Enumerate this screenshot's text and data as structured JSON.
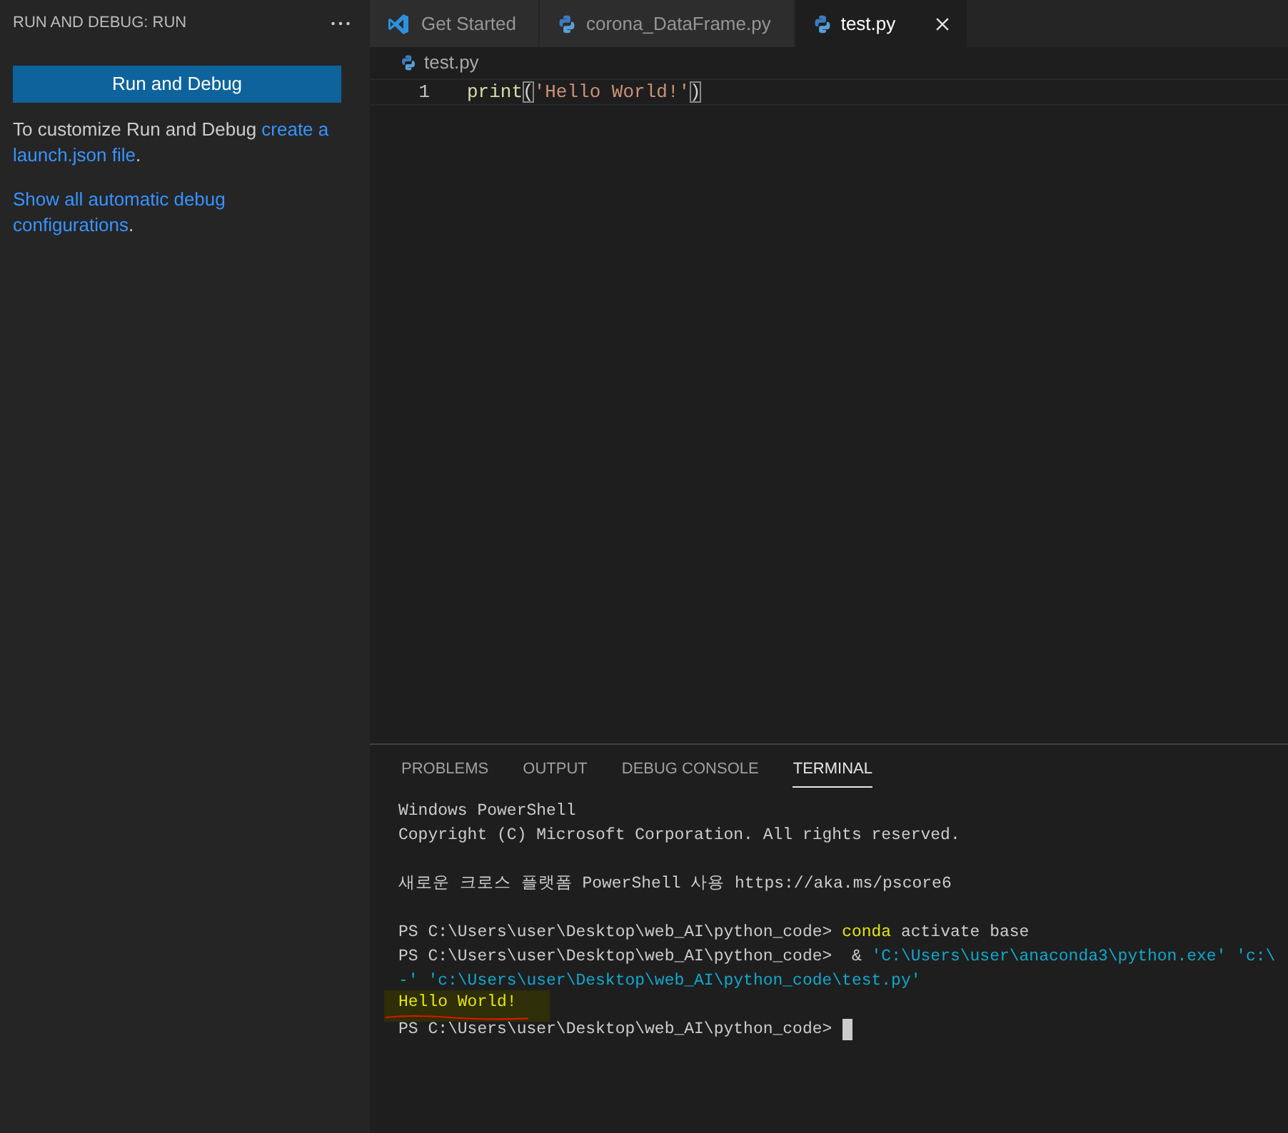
{
  "sidebar": {
    "title": "RUN AND DEBUG: RUN",
    "button": "Run and Debug",
    "paragraphs": [
      {
        "segments": [
          {
            "kind": "text",
            "text": "To customize Run and Debug "
          },
          {
            "kind": "link",
            "text": "create a"
          },
          {
            "kind": "link",
            "text": "launch.json file"
          },
          {
            "kind": "text",
            "text": "."
          }
        ]
      },
      {
        "segments": [
          {
            "kind": "link",
            "text": "Show all automatic debug"
          },
          {
            "kind": "link",
            "text": "configurations"
          },
          {
            "kind": "text",
            "text": "."
          }
        ]
      }
    ]
  },
  "tabs": [
    {
      "label": "Get Started",
      "selected": false
    },
    {
      "label": "corona_DataFrame.py",
      "selected": false
    },
    {
      "label": "test.py",
      "selected": true
    }
  ],
  "breadcrumb": "test.py",
  "editor": {
    "lines": [
      {
        "number": "1",
        "tokens": [
          {
            "kind": "function",
            "text": "print"
          },
          {
            "kind": "bracket",
            "text": "("
          },
          {
            "kind": "string",
            "text": "'Hello World!'"
          },
          {
            "kind": "bracket",
            "text": ")"
          }
        ]
      }
    ]
  },
  "panel": {
    "tabs": [
      {
        "label": "PROBLEMS",
        "selected": false
      },
      {
        "label": "OUTPUT",
        "selected": false
      },
      {
        "label": "DEBUG CONSOLE",
        "selected": false
      },
      {
        "label": "TERMINAL",
        "selected": true
      }
    ],
    "terminal": [
      {
        "kind": "text",
        "cursor": false,
        "segments": [
          {
            "kind": "plain",
            "text": "Windows PowerShell"
          }
        ]
      },
      {
        "kind": "text",
        "cursor": false,
        "segments": [
          {
            "kind": "plain",
            "text": "Copyright (C) Microsoft Corporation. All rights reserved."
          }
        ]
      },
      {
        "kind": "blank"
      },
      {
        "kind": "text",
        "cursor": false,
        "segments": [
          {
            "kind": "plain",
            "text": "새로운 크로스 플랫폼 PowerShell 사용 https://aka.ms/pscore6"
          }
        ]
      },
      {
        "kind": "blank"
      },
      {
        "kind": "text",
        "cursor": false,
        "segments": [
          {
            "kind": "plain",
            "text": "PS C:\\Users\\user\\Desktop\\web_AI\\python_code> "
          },
          {
            "kind": "command",
            "text": "conda"
          },
          {
            "kind": "plain",
            "text": " activate base"
          }
        ]
      },
      {
        "kind": "text",
        "cursor": false,
        "segments": [
          {
            "kind": "plain",
            "text": "PS C:\\Users\\user\\Desktop\\web_AI\\python_code>  & "
          },
          {
            "kind": "string",
            "text": "'C:\\Users\\user\\anaconda3\\python.exe' 'c:\\"
          }
        ]
      },
      {
        "kind": "text",
        "cursor": false,
        "segments": [
          {
            "kind": "string",
            "text": "-' 'c:\\Users\\user\\Desktop\\web_AI\\python_code\\test.py'"
          }
        ]
      },
      {
        "kind": "text",
        "cursor": false,
        "segments": [
          {
            "kind": "marked",
            "text": "Hello World!"
          }
        ]
      },
      {
        "kind": "text",
        "cursor": true,
        "segments": [
          {
            "kind": "plain",
            "text": "PS C:\\Users\\user\\Desktop\\web_AI\\python_code> "
          }
        ]
      }
    ]
  }
}
